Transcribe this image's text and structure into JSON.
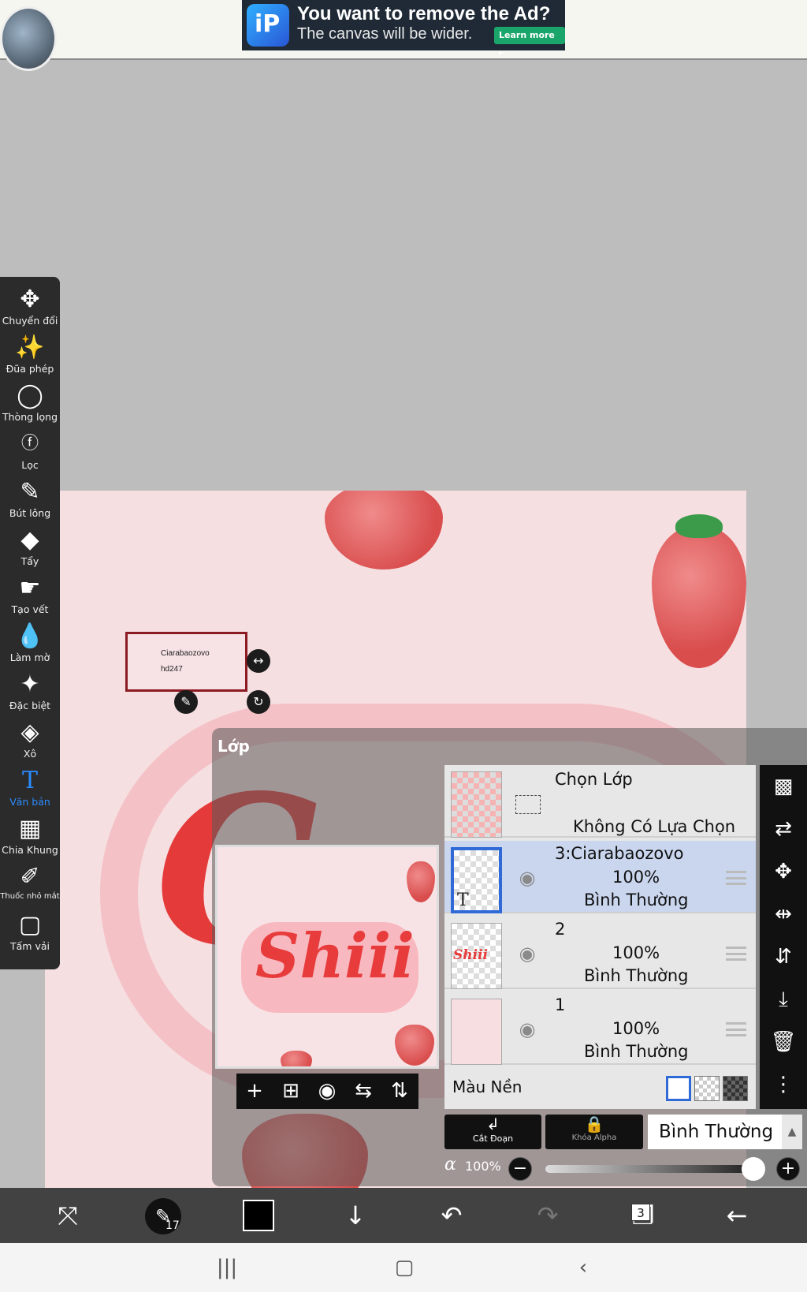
{
  "ad": {
    "title": "You want to remove the Ad?",
    "subtitle": "The canvas will be wider.",
    "learn_more": "Learn more ▸",
    "logo_text": "iP"
  },
  "text_box": {
    "line1": "Ciarabaozovo",
    "line2": "hd247"
  },
  "toolbar": {
    "items": [
      {
        "label": "Chuyển đổi",
        "icon": "move-icon"
      },
      {
        "label": "Đũa phép",
        "icon": "magic-wand-icon"
      },
      {
        "label": "Thòng lọng",
        "icon": "lasso-icon"
      },
      {
        "label": "Lọc",
        "icon": "fx-icon"
      },
      {
        "label": "Bút lông",
        "icon": "brush-icon"
      },
      {
        "label": "Tẩy",
        "icon": "eraser-icon"
      },
      {
        "label": "Tạo vết",
        "icon": "smudge-icon"
      },
      {
        "label": "Làm mờ",
        "icon": "blur-icon"
      },
      {
        "label": "Đặc biệt",
        "icon": "special-icon"
      },
      {
        "label": "Xô",
        "icon": "bucket-icon"
      },
      {
        "label": "Văn bản",
        "icon": "text-icon"
      },
      {
        "label": "Chia Khung",
        "icon": "frame-divider-icon"
      },
      {
        "label": "Thuốc nhỏ mắt",
        "icon": "eyedropper-icon"
      },
      {
        "label": "Tấm vải",
        "icon": "canvas-icon"
      }
    ],
    "active_index": 10
  },
  "layer_panel": {
    "title": "Lớp",
    "preview_word": "Shiii",
    "select_layer": {
      "title": "Chọn Lớp",
      "subtitle": "Không Có Lựa Chọn"
    },
    "layers": [
      {
        "name": "3:Ciarabaozovo",
        "opacity": "100%",
        "mode": "Bình Thường",
        "selected": true,
        "thumb_text": "T"
      },
      {
        "name": "2",
        "opacity": "100%",
        "mode": "Bình Thường",
        "selected": false,
        "thumb_text": "Shiii"
      },
      {
        "name": "1",
        "opacity": "100%",
        "mode": "Bình Thường",
        "selected": false,
        "thumb_text": ""
      }
    ],
    "background_label": "Màu Nền",
    "clip_label": "Cắt Đoạn",
    "alpha_lock_label": "Khóa Alpha",
    "blend_mode": "Bình Thường",
    "alpha_symbol": "α",
    "alpha_value": "100%",
    "alpha_fraction": 1.0
  },
  "bottom_bar": {
    "brush_size": "17",
    "layer_count": "3",
    "color": "#000000"
  },
  "colors": {
    "accent": "#2a8cff",
    "selected_row": "#c9d6ee",
    "canvas_bg": "#f6dfe1"
  }
}
